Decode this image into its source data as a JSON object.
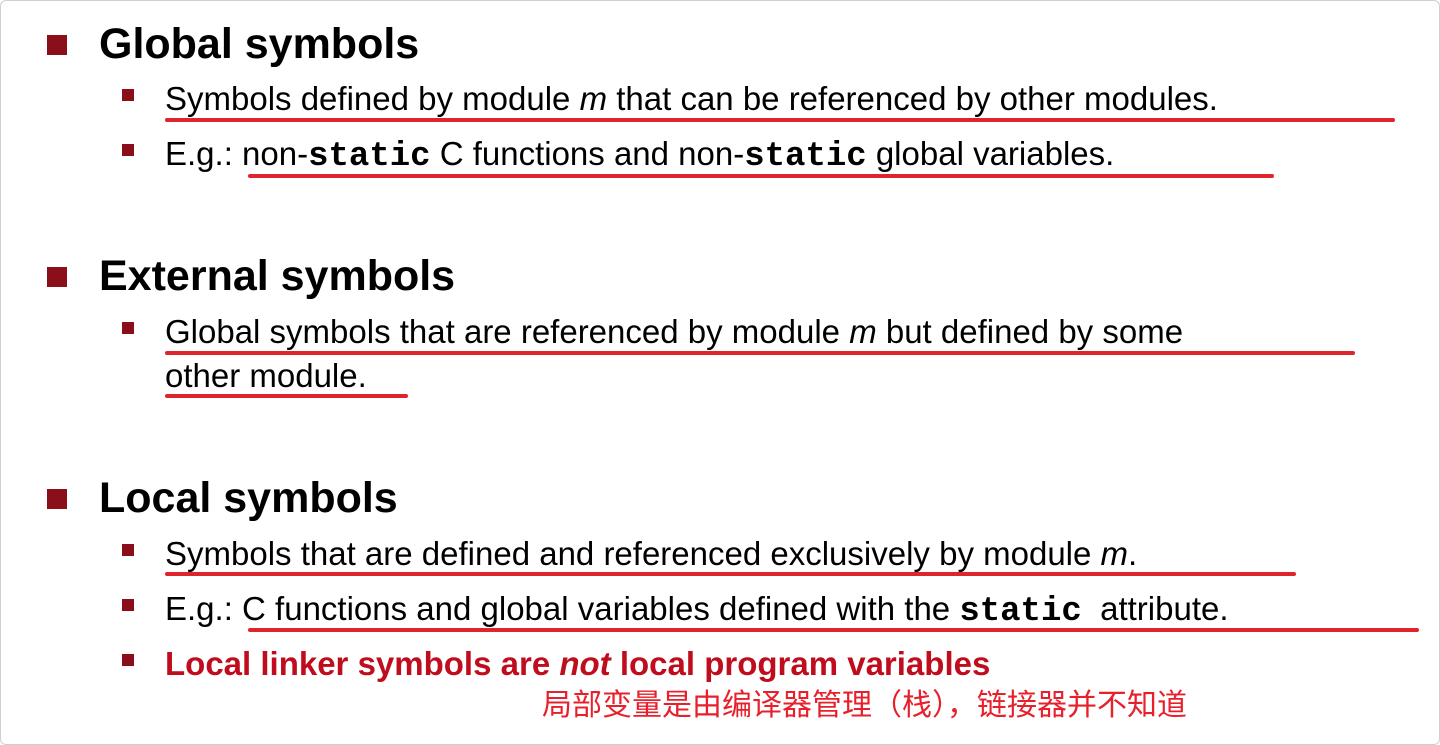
{
  "sections": {
    "global": {
      "title": "Global symbols",
      "item1": {
        "pre": "Symbols defined by module ",
        "m": "m",
        "post": " that can be referenced by other modules."
      },
      "item2": {
        "eg": "E.g.: ",
        "a": "non-",
        "static1": "static",
        "b": " C functions and non-",
        "static2": "static",
        "c": " global variables."
      }
    },
    "external": {
      "title": "External symbols",
      "item1": {
        "pre": "Global symbols that are referenced by module ",
        "m": "m",
        "post": " but defined by some",
        "line2": "other module."
      }
    },
    "local": {
      "title": "Local symbols",
      "item1": {
        "pre": "Symbols that are defined and referenced exclusively by module ",
        "m": "m",
        "post": "."
      },
      "item2": {
        "eg": "E.g.: ",
        "a": "C functions and global variables defined with the ",
        "static": "static",
        "b": "  attribute."
      },
      "item3": {
        "pre": "Local linker symbols are ",
        "not": "not",
        "post": " local program variables"
      },
      "note": "局部变量是由编译器管理（栈），链接器并不知道"
    }
  },
  "colors": {
    "bullet": "#8b0f1a",
    "underline": "#e0242c",
    "emphasis": "#c00d1e"
  }
}
